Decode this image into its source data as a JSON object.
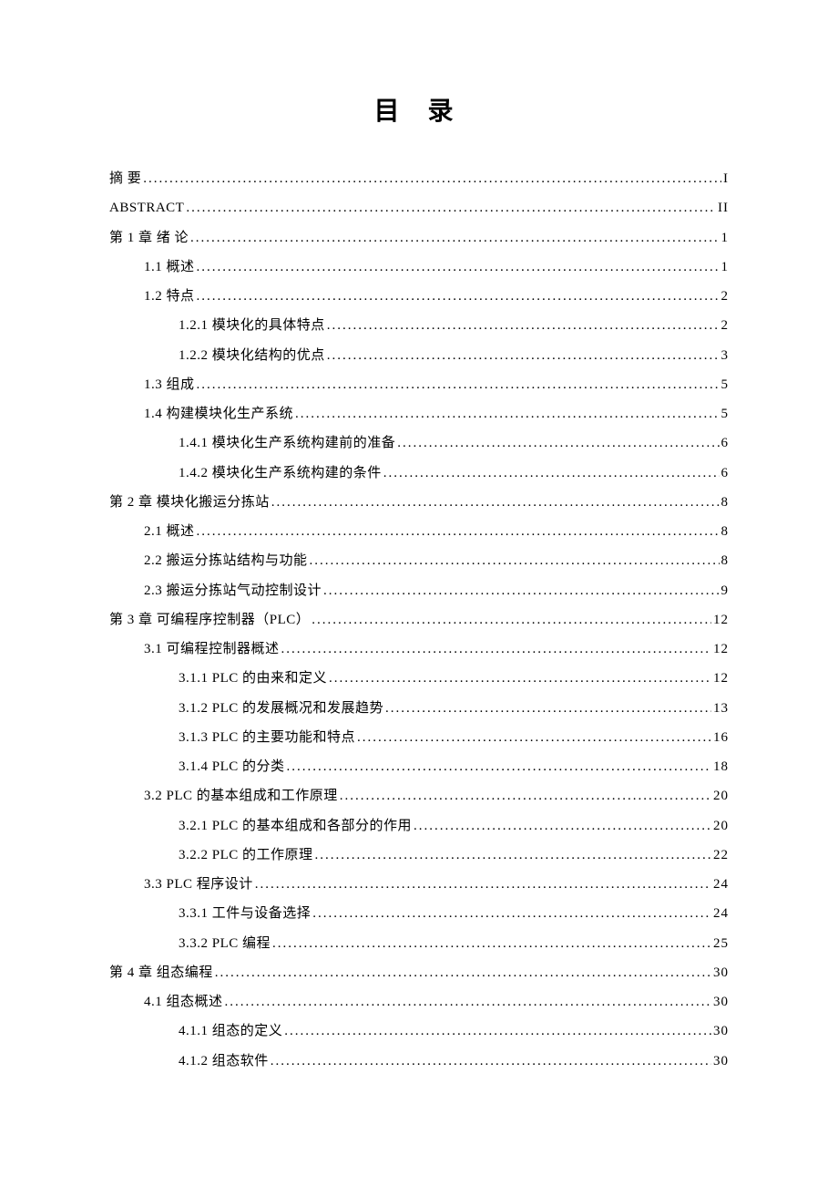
{
  "title": "目  录",
  "toc": [
    {
      "level": 0,
      "label": "摘  要",
      "page": "I"
    },
    {
      "level": 0,
      "label": "ABSTRACT",
      "page": "II"
    },
    {
      "level": 0,
      "label": "第 1 章  绪  论",
      "page": "1"
    },
    {
      "level": 1,
      "label": "1.1  概述",
      "page": "1"
    },
    {
      "level": 1,
      "label": "1.2  特点",
      "page": "2"
    },
    {
      "level": 2,
      "label": "1.2.1  模块化的具体特点",
      "page": "2"
    },
    {
      "level": 2,
      "label": "1.2.2  模块化结构的优点",
      "page": "3"
    },
    {
      "level": 1,
      "label": "1.3  组成",
      "page": "5"
    },
    {
      "level": 1,
      "label": "1.4  构建模块化生产系统",
      "page": "5"
    },
    {
      "level": 2,
      "label": "1.4.1  模块化生产系统构建前的准备",
      "page": "6"
    },
    {
      "level": 2,
      "label": "1.4.2  模块化生产系统构建的条件  ",
      "page": "6"
    },
    {
      "level": 0,
      "label": "第 2 章  模块化搬运分拣站",
      "page": "8"
    },
    {
      "level": 1,
      "label": "2.1  概述",
      "page": "8"
    },
    {
      "level": 1,
      "label": "2.2  搬运分拣站结构与功能",
      "page": "8"
    },
    {
      "level": 1,
      "label": "2.3  搬运分拣站气动控制设计",
      "page": "9"
    },
    {
      "level": 0,
      "label": "第 3 章  可编程序控制器（PLC） ",
      "page": "12"
    },
    {
      "level": 1,
      "label": "3.1  可编程控制器概述",
      "page": "12"
    },
    {
      "level": 2,
      "label": "3.1.1 PLC 的由来和定义",
      "page": "12"
    },
    {
      "level": 2,
      "label": "3.1.2 PLC 的发展概况和发展趋势",
      "page": "13"
    },
    {
      "level": 2,
      "label": "3.1.3 PLC 的主要功能和特点",
      "page": "16"
    },
    {
      "level": 2,
      "label": "3.1.4 PLC 的分类",
      "page": "18"
    },
    {
      "level": 1,
      "label": "3.2 PLC 的基本组成和工作原理 ",
      "page": "20"
    },
    {
      "level": 2,
      "label": "3.2.1 PLC 的基本组成和各部分的作用",
      "page": "20"
    },
    {
      "level": 2,
      "label": "3.2.2 PLC 的工作原理",
      "page": "22"
    },
    {
      "level": 1,
      "label": "3.3 PLC 程序设计",
      "page": "24"
    },
    {
      "level": 2,
      "label": "3.3.1  工件与设备选择",
      "page": "24"
    },
    {
      "level": 2,
      "label": "3.3.2 PLC 编程",
      "page": "25"
    },
    {
      "level": 0,
      "label": "第 4 章  组态编程",
      "page": "30"
    },
    {
      "level": 1,
      "label": "4.1  组态概述",
      "page": "30"
    },
    {
      "level": 2,
      "label": "4.1.1  组态的定义",
      "page": "30"
    },
    {
      "level": 2,
      "label": "4.1.2  组态软件",
      "page": "30"
    }
  ]
}
